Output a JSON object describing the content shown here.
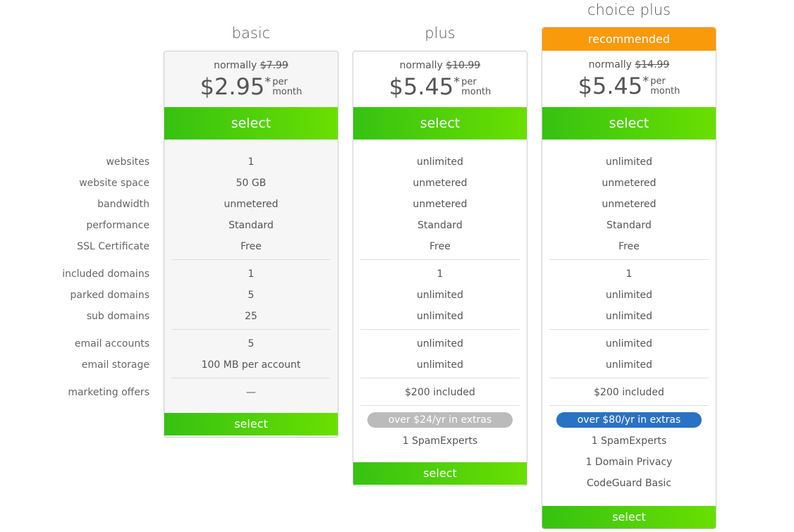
{
  "feature_labels": [
    "websites",
    "website space",
    "bandwidth",
    "performance",
    "SSL Certificate",
    "included domains",
    "parked domains",
    "sub domains",
    "email accounts",
    "email storage",
    "marketing offers"
  ],
  "plans": [
    {
      "name": "basic",
      "recommended": null,
      "normally_label": "normally",
      "normal_price": "$7.99",
      "price": "$2.95",
      "asterisk": "*",
      "per": "per",
      "period": "month",
      "select_label": "select",
      "values": [
        "1",
        "50 GB",
        "unmetered",
        "Standard",
        "Free",
        "1",
        "5",
        "25",
        "5",
        "100 MB per account",
        "—"
      ],
      "extras_badge": null,
      "extras": []
    },
    {
      "name": "plus",
      "recommended": null,
      "normally_label": "normally",
      "normal_price": "$10.99",
      "price": "$5.45",
      "asterisk": "*",
      "per": "per",
      "period": "month",
      "select_label": "select",
      "values": [
        "unlimited",
        "unmetered",
        "unmetered",
        "Standard",
        "Free",
        "1",
        "unlimited",
        "unlimited",
        "unlimited",
        "unlimited",
        "$200 included"
      ],
      "extras_badge": "over $24/yr in extras",
      "extras_badge_color": "#bbbbbb",
      "extras": [
        "1 SpamExperts"
      ]
    },
    {
      "name": "choice plus",
      "recommended": "recommended",
      "recommended_color": "#f99a0b",
      "normally_label": "normally",
      "normal_price": "$14.99",
      "price": "$5.45",
      "asterisk": "*",
      "per": "per",
      "period": "month",
      "select_label": "select",
      "values": [
        "unlimited",
        "unmetered",
        "unmetered",
        "Standard",
        "Free",
        "1",
        "unlimited",
        "unlimited",
        "unlimited",
        "unlimited",
        "$200 included"
      ],
      "extras_badge": "over $80/yr in extras",
      "extras_badge_color": "#2a72c4",
      "extras": [
        "1 SpamExperts",
        "1 Domain Privacy",
        "CodeGuard Basic"
      ]
    }
  ],
  "colors": {
    "select_start": "#36c212",
    "select_end": "#6adf00",
    "recommended": "#f99a0b"
  }
}
